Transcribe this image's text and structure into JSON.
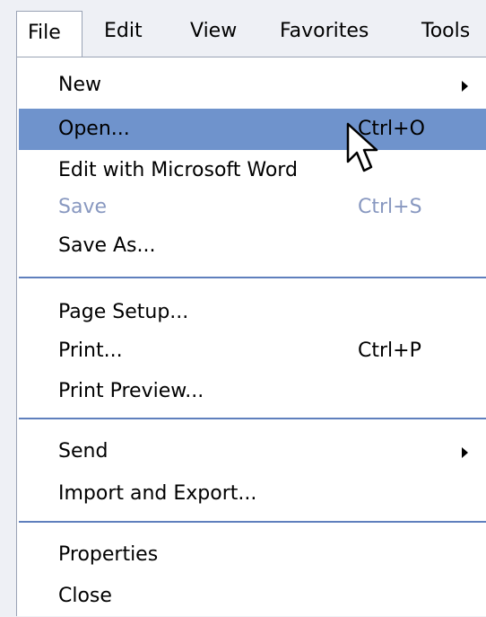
{
  "menubar": {
    "items": [
      {
        "label": "File",
        "mnemonic": "F"
      },
      {
        "label": "Edit",
        "mnemonic": "E"
      },
      {
        "label": "View",
        "mnemonic": "V"
      },
      {
        "label": "Favorites",
        "mnemonic": "a"
      },
      {
        "label": "Tools",
        "mnemonic": "T"
      }
    ]
  },
  "file_menu": {
    "items": [
      {
        "label": "New",
        "shortcut": "",
        "submenu": true,
        "state": "normal"
      },
      {
        "label": "Open...",
        "shortcut": "Ctrl+O",
        "submenu": false,
        "state": "highlighted"
      },
      {
        "label": "Edit with Microsoft Word",
        "shortcut": "",
        "submenu": false,
        "state": "normal"
      },
      {
        "label": "Save",
        "shortcut": "Ctrl+S",
        "submenu": false,
        "state": "disabled"
      },
      {
        "label": "Save As...",
        "shortcut": "",
        "submenu": false,
        "state": "normal"
      },
      {
        "label": "Page Setup...",
        "shortcut": "",
        "submenu": false,
        "state": "normal"
      },
      {
        "label": "Print...",
        "shortcut": "Ctrl+P",
        "submenu": false,
        "state": "normal"
      },
      {
        "label": "Print Preview...",
        "shortcut": "",
        "submenu": false,
        "state": "normal"
      },
      {
        "label": "Send",
        "shortcut": "",
        "submenu": true,
        "state": "normal"
      },
      {
        "label": "Import and Export...",
        "shortcut": "",
        "submenu": false,
        "state": "normal"
      },
      {
        "label": "Properties",
        "shortcut": "",
        "submenu": false,
        "state": "normal"
      },
      {
        "label": "Close",
        "shortcut": "",
        "submenu": false,
        "state": "normal"
      }
    ]
  },
  "colors": {
    "menubar_bg": "#eef0f5",
    "highlight": "#6f93cc",
    "separator": "#5f7fbd",
    "disabled_text": "#8898c0"
  },
  "icons": [
    "submenu-arrow-icon",
    "mouse-pointer-icon"
  ]
}
